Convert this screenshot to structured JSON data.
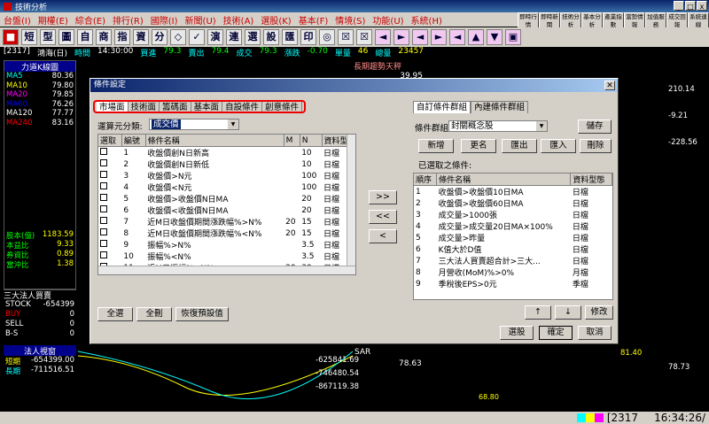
{
  "app": {
    "title": "技術分析"
  },
  "window_controls": [
    "_",
    "□",
    "x"
  ],
  "menu": [
    "台盤(I)",
    "期權(E)",
    "綜合(E)",
    "排行(R)",
    "國際(I)",
    "新聞(U)",
    "技術(A)",
    "選股(K)",
    "基本(F)",
    "情境(S)",
    "功能(U)",
    "系統(H)"
  ],
  "quick_buttons": [
    "即時行情",
    "即時新聞",
    "技術分析",
    "基本分析",
    "產業指數",
    "當勢情報",
    "加值服務",
    "成交回報",
    "系統連線"
  ],
  "toolbar_icons": [
    "■",
    "短",
    "型",
    "圖",
    "自",
    "商",
    "指",
    "資",
    "分",
    "◇",
    "✓",
    "演",
    "連",
    "選",
    "設",
    "匯",
    "印",
    "◎",
    "☒",
    "☒",
    "◄",
    "►",
    "◄",
    "►",
    "◄",
    "▲",
    "▼",
    "▣"
  ],
  "infobar": {
    "code": "[2317]",
    "name": "鴻海(日)",
    "time_label": "時間",
    "time": "14:30:00",
    "buy_label": "買進",
    "buy": "79.3",
    "sell_label": "賣出",
    "sell": "79.4",
    "deal_label": "成交",
    "deal": "79.3",
    "change_label": "漲跌",
    "change": "-0.70",
    "vol_label": "單量",
    "vol": "46",
    "total_label": "總量",
    "total": "23457"
  },
  "left_panel": {
    "title": "力道K線圖",
    "ma": [
      {
        "name": "MA5",
        "value": "80.36",
        "color": "#0ff"
      },
      {
        "name": "MA10",
        "value": "79.80",
        "color": "#ff0"
      },
      {
        "name": "MA20",
        "value": "79.85",
        "color": "#f0f"
      },
      {
        "name": "MA60",
        "value": "76.26",
        "color": "#00f"
      },
      {
        "name": "MA120",
        "value": "77.77",
        "color": "#fff"
      },
      {
        "name": "MA240",
        "value": "83.16",
        "color": "#f00"
      }
    ],
    "stats": [
      {
        "name": "股本(億)",
        "value": "1183.59"
      },
      {
        "name": "本益比",
        "value": "9.33"
      },
      {
        "name": "券資比",
        "value": "0.89"
      },
      {
        "name": "當沖比",
        "value": "1.38"
      }
    ],
    "inst_title": "三大法人買賣",
    "inst": [
      {
        "name": "STOCK",
        "value": "-654399"
      },
      {
        "name": "BUY",
        "value": "0"
      },
      {
        "name": "SELL",
        "value": "0"
      },
      {
        "name": "B-S",
        "value": "0"
      }
    ],
    "legal_title": "法人視窗",
    "legal": [
      {
        "name": "短期",
        "value": "-654399.00"
      },
      {
        "name": "長期",
        "value": "-711516.51"
      }
    ],
    "axis_vals": [
      "-625841.69",
      "-746480.54",
      "-867119.38"
    ]
  },
  "right_panel": {
    "vals": [
      "210.14",
      "-9.21",
      "-228.56",
      "81.40",
      "78.73"
    ],
    "sar_label": "SAR",
    "sar_value": "78.63",
    "low": "68.80"
  },
  "chart_overlay": {
    "title": "長期趨勢天秤",
    "value": "39.95"
  },
  "status": {
    "code": "[2317",
    "time": "16:34:26/"
  },
  "dialog": {
    "title": "條件設定",
    "tabs": [
      "市場面",
      "技術面",
      "籌碼面",
      "基本面",
      "自設條件",
      "創意條件"
    ],
    "calc_label": "運算元分類:",
    "calc_value": "成交價",
    "columns": [
      "選取",
      "編號",
      "條件名稱",
      "M",
      "N",
      "資料型"
    ],
    "rows": [
      {
        "no": "1",
        "name": "收盤價創N日新高",
        "m": "",
        "n": "10",
        "type": "日檔"
      },
      {
        "no": "2",
        "name": "收盤價創N日新低",
        "m": "",
        "n": "10",
        "type": "日檔"
      },
      {
        "no": "3",
        "name": "收盤價>N元",
        "m": "",
        "n": "100",
        "type": "日檔"
      },
      {
        "no": "4",
        "name": "收盤價<N元",
        "m": "",
        "n": "100",
        "type": "日檔"
      },
      {
        "no": "5",
        "name": "收盤價>收盤價N日MA",
        "m": "",
        "n": "20",
        "type": "日檔"
      },
      {
        "no": "6",
        "name": "收盤價<收盤價N日MA",
        "m": "",
        "n": "20",
        "type": "日檔"
      },
      {
        "no": "7",
        "name": "近M日收盤價期間漲跌幅%>N%",
        "m": "20",
        "n": "15",
        "type": "日檔"
      },
      {
        "no": "8",
        "name": "近M日收盤價期間漲跌幅%<N%",
        "m": "20",
        "n": "15",
        "type": "日檔"
      },
      {
        "no": "9",
        "name": "振幅%>N%",
        "m": "",
        "n": "3.5",
        "type": "日檔"
      },
      {
        "no": "10",
        "name": "振幅%<N%",
        "m": "",
        "n": "3.5",
        "type": "日檔"
      },
      {
        "no": "11",
        "name": "近M日振幅%>N%",
        "m": "20",
        "n": "30",
        "type": "日檔"
      }
    ],
    "mid_buttons": [
      ">>",
      "<<",
      "<"
    ],
    "bottom_left": [
      "全選",
      "全刪",
      "恢復預設值"
    ],
    "right_tabs": [
      "自訂條件群組",
      "內建條件群組"
    ],
    "group_label": "條件群組:",
    "group_value": "封關概念股",
    "save": "儲存",
    "group_buttons": [
      "新增",
      "更名",
      "匯出",
      "匯入",
      "刪除"
    ],
    "selected_label": "已選取之條件:",
    "sel_columns": [
      "順序",
      "條件名稱",
      "資料型態"
    ],
    "sel_rows": [
      {
        "no": "1",
        "name": "收盤價>收盤價10日MA",
        "type": "日檔"
      },
      {
        "no": "2",
        "name": "收盤價>收盤價60日MA",
        "type": "日檔"
      },
      {
        "no": "3",
        "name": "成交量>1000張",
        "type": "日檔"
      },
      {
        "no": "4",
        "name": "成交量>成交量20日MA×100%",
        "type": "日檔"
      },
      {
        "no": "5",
        "name": "成交量>昨量",
        "type": "日檔"
      },
      {
        "no": "6",
        "name": "K值大於D值",
        "type": "日檔"
      },
      {
        "no": "7",
        "name": "三大法人買賣超合計>三大...",
        "type": "日檔"
      },
      {
        "no": "8",
        "name": "月營收(MoM)%>0%",
        "type": "月檔"
      },
      {
        "no": "9",
        "name": "季稅後EPS>0元",
        "type": "季檔"
      }
    ],
    "order_buttons": [
      "↑",
      "↓",
      "修改"
    ],
    "footer": [
      "選股",
      "確定",
      "取消"
    ]
  }
}
